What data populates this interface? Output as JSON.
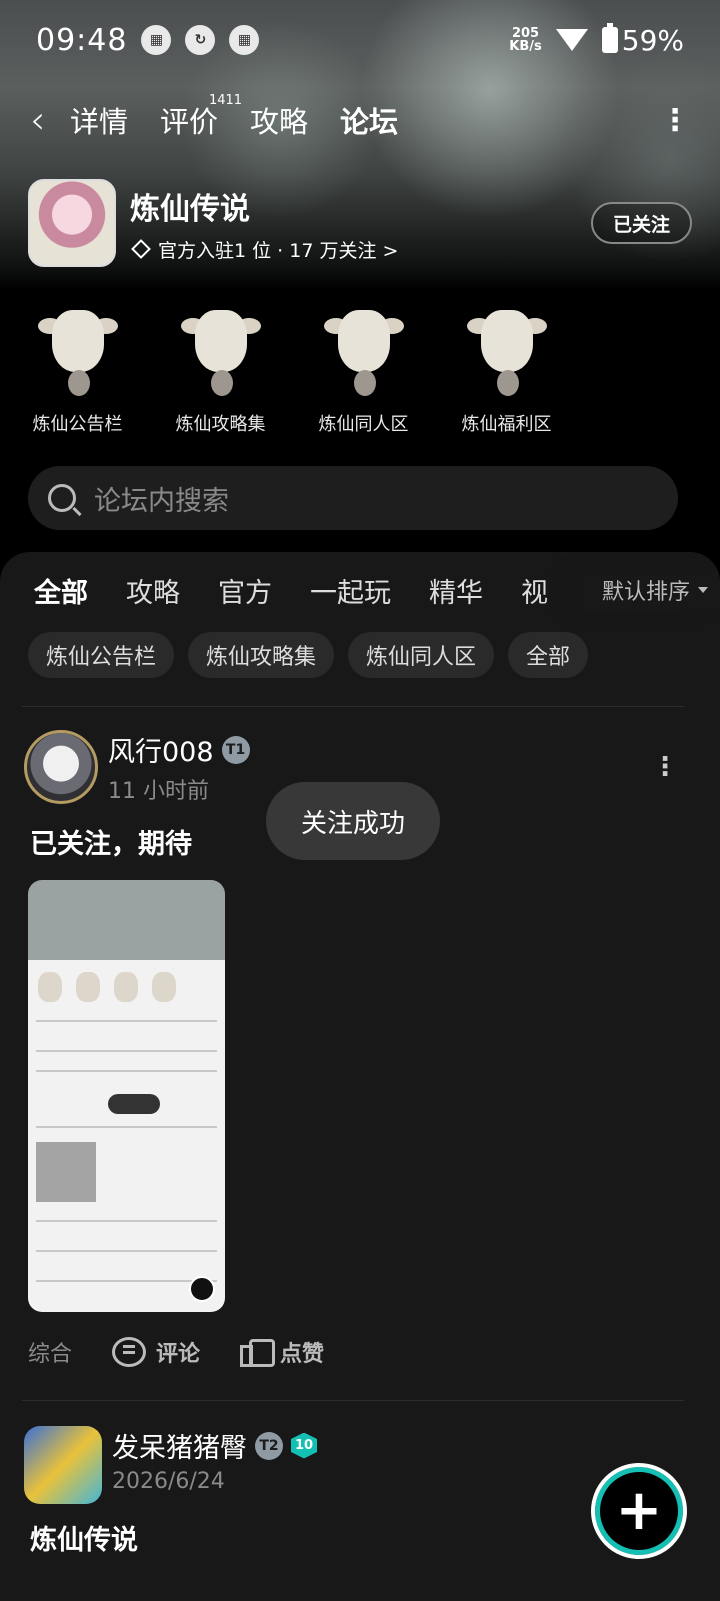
{
  "status_bar": {
    "time": "09:48",
    "speed_value": "205",
    "speed_unit": "KB/s",
    "battery": "59%",
    "icons": [
      "calendar-icon",
      "phone-sync-icon",
      "calendar-icon",
      "wifi-icon",
      "battery-icon"
    ]
  },
  "nav": {
    "tabs": [
      {
        "label": "详情"
      },
      {
        "label": "评价",
        "count": "1411"
      },
      {
        "label": "攻略"
      },
      {
        "label": "论坛",
        "active": true
      }
    ]
  },
  "game": {
    "title": "炼仙传说",
    "subtitle": "官方入驻1 位 · 17 万关注 >",
    "follow_label": "已关注"
  },
  "boards": [
    {
      "label": "炼仙公告栏"
    },
    {
      "label": "炼仙攻略集"
    },
    {
      "label": "炼仙同人区"
    },
    {
      "label": "炼仙福利区"
    }
  ],
  "search": {
    "placeholder": "论坛内搜索"
  },
  "categories": {
    "tabs": [
      "全部",
      "攻略",
      "官方",
      "一起玩",
      "精华",
      "视"
    ],
    "sort_label": "默认排序"
  },
  "chips": [
    "炼仙公告栏",
    "炼仙攻略集",
    "炼仙同人区",
    "全部"
  ],
  "posts": [
    {
      "author": "风行008",
      "badge": "T1",
      "time": "11 小时前",
      "title": "已关注，期待",
      "tag": "综合",
      "comment_label": "评论",
      "like_label": "点赞"
    },
    {
      "author": "发呆猪猪臀",
      "badge": "T2",
      "level": "10",
      "time": "2026/6/24",
      "title": "炼仙传说"
    }
  ],
  "toast": "关注成功",
  "colors": {
    "accent": "#14c0b3",
    "background": "#000000",
    "card": "#181818"
  }
}
